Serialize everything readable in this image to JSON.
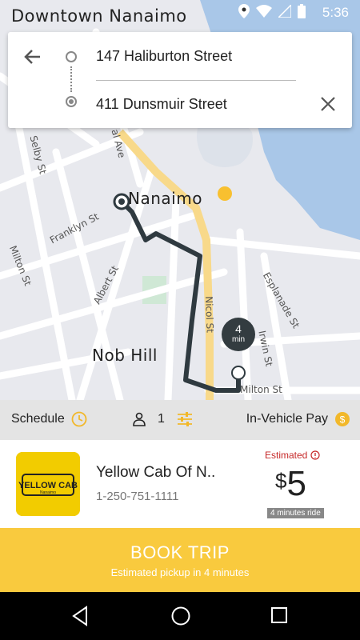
{
  "status_bar": {
    "title": "Downtown Nanaimo",
    "time": "5:36",
    "icons": [
      "location-icon",
      "wifi-icon",
      "signal-icon",
      "battery-icon"
    ]
  },
  "map": {
    "area_labels": {
      "city": "Nanaimo",
      "neighborhood": "Nob Hill"
    },
    "streets": {
      "selby": "Selby St",
      "franklyn": "Franklyn St",
      "milton_left": "Milton St",
      "albert": "Albert St",
      "nicol": "Nicol St",
      "esplanade": "Esplanade St",
      "irwin": "Irwin St",
      "milton_bottom": "Milton St",
      "st_top": "St",
      "ave": "al Ave"
    },
    "eta": {
      "value": "4",
      "unit": "min"
    },
    "colors": {
      "route": "#2f3a40",
      "highway": "#f8d98a",
      "water": "#a9c7e8",
      "land": "#e8e9ee",
      "park": "#cfe8d5",
      "poi": "#f8c030"
    }
  },
  "route": {
    "origin": "147 Haliburton Street",
    "destination": "411 Dunsmuir Street"
  },
  "options": {
    "schedule": "Schedule",
    "passengers": "1",
    "payment": "In-Vehicle Pay"
  },
  "cab": {
    "logo_text": "YELLOW CAB",
    "logo_sub": "Nanaimo",
    "name": "Yellow Cab Of N..",
    "phone": "1-250-751-1111",
    "estimated_label": "Estimated",
    "price_symbol": "$",
    "price_value": "5",
    "ride_time": "4 minutes ride"
  },
  "book": {
    "label": "BOOK TRIP",
    "subtitle": "Estimated pickup in 4 minutes",
    "color": "#f9ca3e"
  }
}
